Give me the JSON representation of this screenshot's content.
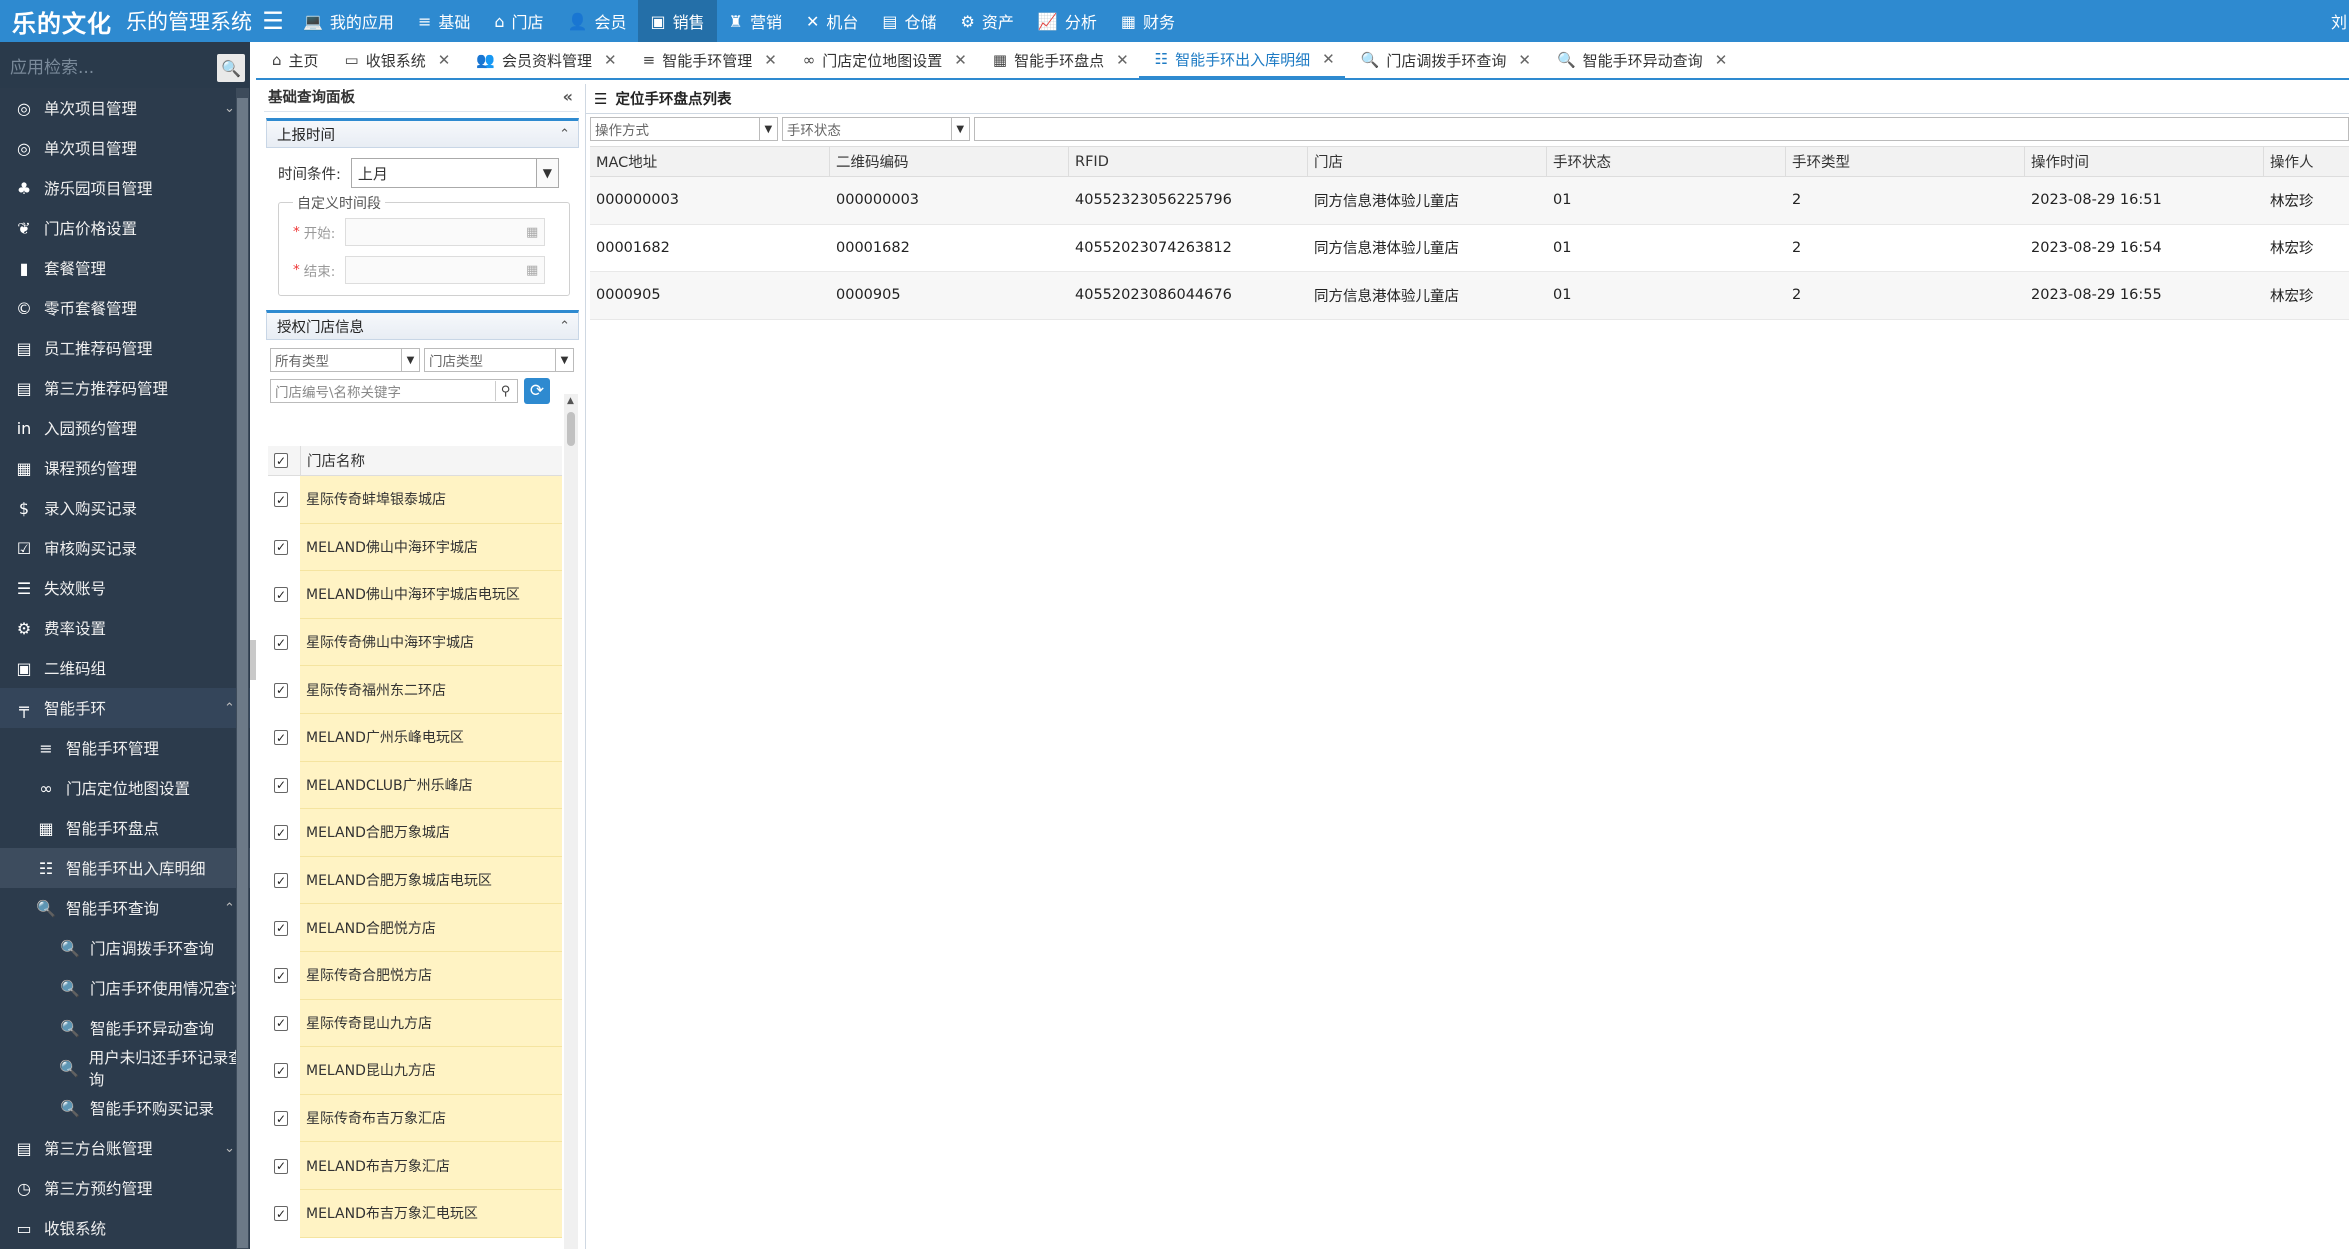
{
  "topbar": {
    "brand": "乐的文化",
    "system_name": "乐的管理系统",
    "user": "刘",
    "menu": [
      {
        "icon": "laptop-icon",
        "glyph": "💻",
        "label": "我的应用"
      },
      {
        "icon": "database-icon",
        "glyph": "≡",
        "label": "基础"
      },
      {
        "icon": "sitemap-icon",
        "glyph": "⌂",
        "label": "门店"
      },
      {
        "icon": "user-icon",
        "glyph": "👤",
        "label": "会员"
      },
      {
        "icon": "briefcase-icon",
        "glyph": "▣",
        "label": "销售"
      },
      {
        "icon": "marketing-icon",
        "glyph": "♜",
        "label": "营销"
      },
      {
        "icon": "gamepad-icon",
        "glyph": "✕",
        "label": "机台"
      },
      {
        "icon": "box-icon",
        "glyph": "▤",
        "label": "仓储"
      },
      {
        "icon": "assets-icon",
        "glyph": "⚙",
        "label": "资产"
      },
      {
        "icon": "chart-icon",
        "glyph": "📈",
        "label": "分析"
      },
      {
        "icon": "finance-icon",
        "glyph": "▦",
        "label": "财务"
      }
    ],
    "active_menu": 4
  },
  "sidebar": {
    "search_placeholder": "应用检索...",
    "items": [
      {
        "icon": "gamepad-icon",
        "glyph": "◎",
        "label": "单次项目管理",
        "level": 0,
        "arrow": "⌄"
      },
      {
        "icon": "gamepad-icon",
        "glyph": "◎",
        "label": "单次项目管理",
        "level": 0
      },
      {
        "icon": "park-icon",
        "glyph": "♣",
        "label": "游乐园项目管理",
        "level": 0
      },
      {
        "icon": "leaf-icon",
        "glyph": "❦",
        "label": "门店价格设置",
        "level": 0
      },
      {
        "icon": "bag-icon",
        "glyph": "▮",
        "label": "套餐管理",
        "level": 0
      },
      {
        "icon": "coin-icon",
        "glyph": "©",
        "label": "零币套餐管理",
        "level": 0
      },
      {
        "icon": "list-icon",
        "glyph": "▤",
        "label": "员工推荐码管理",
        "level": 0
      },
      {
        "icon": "list-icon",
        "glyph": "▤",
        "label": "第三方推荐码管理",
        "level": 0
      },
      {
        "icon": "linkedin-icon",
        "glyph": "in",
        "label": "入园预约管理",
        "level": 0
      },
      {
        "icon": "calendar-icon",
        "glyph": "▦",
        "label": "课程预约管理",
        "level": 0
      },
      {
        "icon": "dollar-icon",
        "glyph": "$",
        "label": "录入购买记录",
        "level": 0
      },
      {
        "icon": "check-icon",
        "glyph": "☑",
        "label": "审核购买记录",
        "level": 0
      },
      {
        "icon": "list-icon",
        "glyph": "☰",
        "label": "失效账号",
        "level": 0
      },
      {
        "icon": "gear-icon",
        "glyph": "⚙",
        "label": "费率设置",
        "level": 0
      },
      {
        "icon": "qrcode-icon",
        "glyph": "▣",
        "label": "二维码组",
        "level": 0
      },
      {
        "icon": "signpost-icon",
        "glyph": "╤",
        "label": "智能手环",
        "level": 0,
        "arrow": "⌃",
        "open": true
      },
      {
        "icon": "database-icon",
        "glyph": "≡",
        "label": "智能手环管理",
        "level": 1
      },
      {
        "icon": "link-icon",
        "glyph": "∞",
        "label": "门店定位地图设置",
        "level": 1
      },
      {
        "icon": "calculator-icon",
        "glyph": "▦",
        "label": "智能手环盘点",
        "level": 1
      },
      {
        "icon": "list-icon",
        "glyph": "☷",
        "label": "智能手环出入库明细",
        "level": 1,
        "current": true
      },
      {
        "icon": "search-icon",
        "glyph": "🔍",
        "label": "智能手环查询",
        "level": 1,
        "arrow": "⌃"
      },
      {
        "icon": "search-icon",
        "glyph": "🔍",
        "label": "门店调拨手环查询",
        "level": 2
      },
      {
        "icon": "search-icon",
        "glyph": "🔍",
        "label": "门店手环使用情况查询",
        "level": 2
      },
      {
        "icon": "search-icon",
        "glyph": "🔍",
        "label": "智能手环异动查询",
        "level": 2
      },
      {
        "icon": "search-icon",
        "glyph": "🔍",
        "label": "用户未归还手环记录查询",
        "level": 2
      },
      {
        "icon": "search-icon",
        "glyph": "🔍",
        "label": "智能手环购买记录",
        "level": 2
      },
      {
        "icon": "list-icon",
        "glyph": "▤",
        "label": "第三方台账管理",
        "level": 0,
        "arrow": "⌄"
      },
      {
        "icon": "clock-icon",
        "glyph": "◷",
        "label": "第三方预约管理",
        "level": 0
      },
      {
        "icon": "laptop-icon",
        "glyph": "▭",
        "label": "收银系统",
        "level": 0
      }
    ]
  },
  "tabs": [
    {
      "icon": "home-icon",
      "glyph": "⌂",
      "label": "主页",
      "closable": false
    },
    {
      "icon": "laptop-icon",
      "glyph": "▭",
      "label": "收银系统",
      "closable": true
    },
    {
      "icon": "users-icon",
      "glyph": "👥",
      "label": "会员资料管理",
      "closable": true
    },
    {
      "icon": "database-icon",
      "glyph": "≡",
      "label": "智能手环管理",
      "closable": true
    },
    {
      "icon": "link-icon",
      "glyph": "∞",
      "label": "门店定位地图设置",
      "closable": true
    },
    {
      "icon": "calculator-icon",
      "glyph": "▦",
      "label": "智能手环盘点",
      "closable": true
    },
    {
      "icon": "list-icon",
      "glyph": "☷",
      "label": "智能手环出入库明细",
      "closable": true,
      "active": true
    },
    {
      "icon": "search-icon",
      "glyph": "🔍",
      "label": "门店调拨手环查询",
      "closable": true
    },
    {
      "icon": "search-icon",
      "glyph": "🔍",
      "label": "智能手环异动查询",
      "closable": true
    }
  ],
  "left_panel": {
    "title": "基础查询面板",
    "report_time": {
      "title": "上报时间",
      "time_condition_label": "时间条件:",
      "time_condition_value": "上月",
      "custom_legend": "自定义时间段",
      "start_label": "开始:",
      "end_label": "结束:"
    },
    "stores": {
      "title": "授权门店信息",
      "type_select": "所有类型",
      "store_type_select": "门店类型",
      "search_placeholder": "门店编号\\名称关键字",
      "column": "门店名称",
      "items": [
        "星际传奇蚌埠银泰城店",
        "MELAND佛山中海环宇城店",
        "MELAND佛山中海环宇城店电玩区",
        "星际传奇佛山中海环宇城店",
        "星际传奇福州东二环店",
        "MELAND广州乐峰电玩区",
        "MELANDCLUB广州乐峰店",
        "MELAND合肥万象城店",
        "MELAND合肥万象城店电玩区",
        "MELAND合肥悦方店",
        "星际传奇合肥悦方店",
        "星际传奇昆山九方店",
        "MELAND昆山九方店",
        "星际传奇布吉万象汇店",
        "MELAND布吉万象汇店",
        "MELAND布吉万象汇电玩区"
      ]
    }
  },
  "right_panel": {
    "title": "定位手环盘点列表",
    "filter_op": "操作方式",
    "filter_status": "手环状态",
    "columns": [
      "MAC地址",
      "二维码编码",
      "RFID",
      "门店",
      "手环状态",
      "手环类型",
      "操作时间",
      "操作人"
    ],
    "rows": [
      [
        "000000003",
        "000000003",
        "40552323056225796",
        "同方信息港体验儿童店",
        "01",
        "2",
        "2023-08-29 16:51",
        "林宏珍"
      ],
      [
        "00001682",
        "00001682",
        "40552023074263812",
        "同方信息港体验儿童店",
        "01",
        "2",
        "2023-08-29 16:54",
        "林宏珍"
      ],
      [
        "0000905",
        "0000905",
        "40552023086044676",
        "同方信息港体验儿童店",
        "01",
        "2",
        "2023-08-29 16:55",
        "林宏珍"
      ]
    ]
  }
}
